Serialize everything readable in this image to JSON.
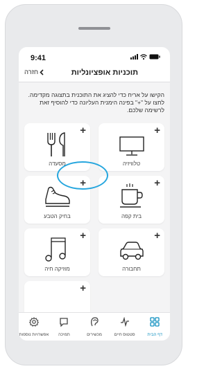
{
  "status": {
    "time": "9:41"
  },
  "nav": {
    "title": "תוכניות אופציונליות",
    "back_label": "חזרה"
  },
  "instructions": "הקישו על אריח כדי להציג את התוכנית בתצוגה מקדימה. לחצו על \"+\" בפינה הימנית העליונה כדי להוסיף זאת לרשימה שלכם.",
  "cards": [
    {
      "label": "טלוויזיה",
      "icon": "tv-icon",
      "action": "+"
    },
    {
      "label": "מסעדה",
      "icon": "fork-knife-icon",
      "action": "+"
    },
    {
      "label": "בית קפה",
      "icon": "coffee-cup-icon",
      "action": "+"
    },
    {
      "label": "בחיק הטבע",
      "icon": "sneaker-icon",
      "action": "+"
    },
    {
      "label": "תחבורה",
      "icon": "car-icon",
      "action": "+"
    },
    {
      "label": "מוזיקה חיה",
      "icon": "music-note-icon",
      "action": "+"
    },
    {
      "label": "",
      "icon": "",
      "action": "+"
    }
  ],
  "tabs": [
    {
      "label": "דף הבית",
      "icon": "home-grid-icon",
      "active": true
    },
    {
      "label": "סטטוס חיים",
      "icon": "activity-icon",
      "active": false
    },
    {
      "label": "מכשירים",
      "icon": "hearing-aid-icon",
      "active": false
    },
    {
      "label": "תמיכה",
      "icon": "chat-icon",
      "active": false
    },
    {
      "label": "אפשרויות נוספות",
      "icon": "gear-icon",
      "active": false
    }
  ],
  "colors": {
    "accent": "#0e8fbf",
    "highlight": "#26a6de",
    "background": "#f4f4f5"
  }
}
